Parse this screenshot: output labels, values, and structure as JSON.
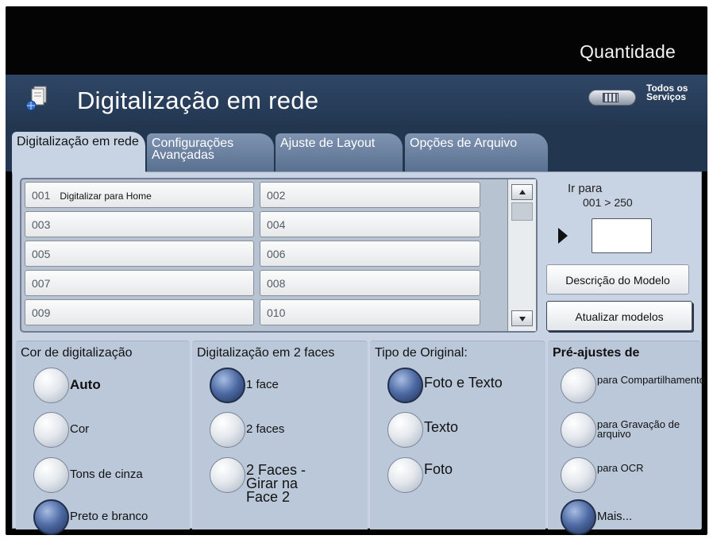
{
  "header": {
    "quantity_label": "Quantidade",
    "title": "Digitalização em rede",
    "all_services_label": "Todos os Serviços"
  },
  "tabs": [
    {
      "label": "Digitalização em rede",
      "active": true
    },
    {
      "label": "Configurações Avançadas",
      "active": false
    },
    {
      "label": "Ajuste de Layout",
      "active": false
    },
    {
      "label": "Opções de Arquivo",
      "active": false
    }
  ],
  "template_list": {
    "items": [
      {
        "number": "001",
        "name": "Digitalizar para Home"
      },
      {
        "number": "002",
        "name": ""
      },
      {
        "number": "003",
        "name": ""
      },
      {
        "number": "004",
        "name": ""
      },
      {
        "number": "005",
        "name": ""
      },
      {
        "number": "006",
        "name": ""
      },
      {
        "number": "007",
        "name": ""
      },
      {
        "number": "008",
        "name": ""
      },
      {
        "number": "009",
        "name": ""
      },
      {
        "number": "010",
        "name": ""
      }
    ]
  },
  "goto": {
    "label": "Ir para",
    "range": "001 > 250",
    "value": ""
  },
  "side_buttons": {
    "model_description": "Descrição do Modelo",
    "update_models": "Atualizar modelos"
  },
  "scan_color": {
    "title": "Cor de digitalização",
    "options": [
      {
        "label": "Auto",
        "selected": false
      },
      {
        "label": "Cor",
        "selected": false
      },
      {
        "label": "Tons de cinza",
        "selected": false
      },
      {
        "label": "Preto e branco",
        "selected": true
      }
    ]
  },
  "scan_sides": {
    "title": "Digitalização em 2 faces",
    "options": [
      {
        "label": "1 face",
        "selected": true
      },
      {
        "label": "2 faces",
        "selected": false
      },
      {
        "label": "2 Faces - Girar na Face 2",
        "selected": false
      }
    ]
  },
  "original_type": {
    "title": "Tipo de Original:",
    "options": [
      {
        "label": "Foto e Texto",
        "selected": true
      },
      {
        "label": "Texto",
        "selected": false
      },
      {
        "label": "Foto",
        "selected": false
      }
    ]
  },
  "presets": {
    "title": "Pré-ajustes de",
    "options": [
      {
        "label": "para Compartilhamento",
        "selected": false
      },
      {
        "label": "para Gravação de arquivo",
        "selected": false
      },
      {
        "label": "para OCR",
        "selected": false
      },
      {
        "label": "Mais...",
        "selected": true
      }
    ]
  },
  "colors": {
    "header_bg": "#223650",
    "panel_bg": "#c8d4e4",
    "selected_radio": "#4d6aa3"
  }
}
